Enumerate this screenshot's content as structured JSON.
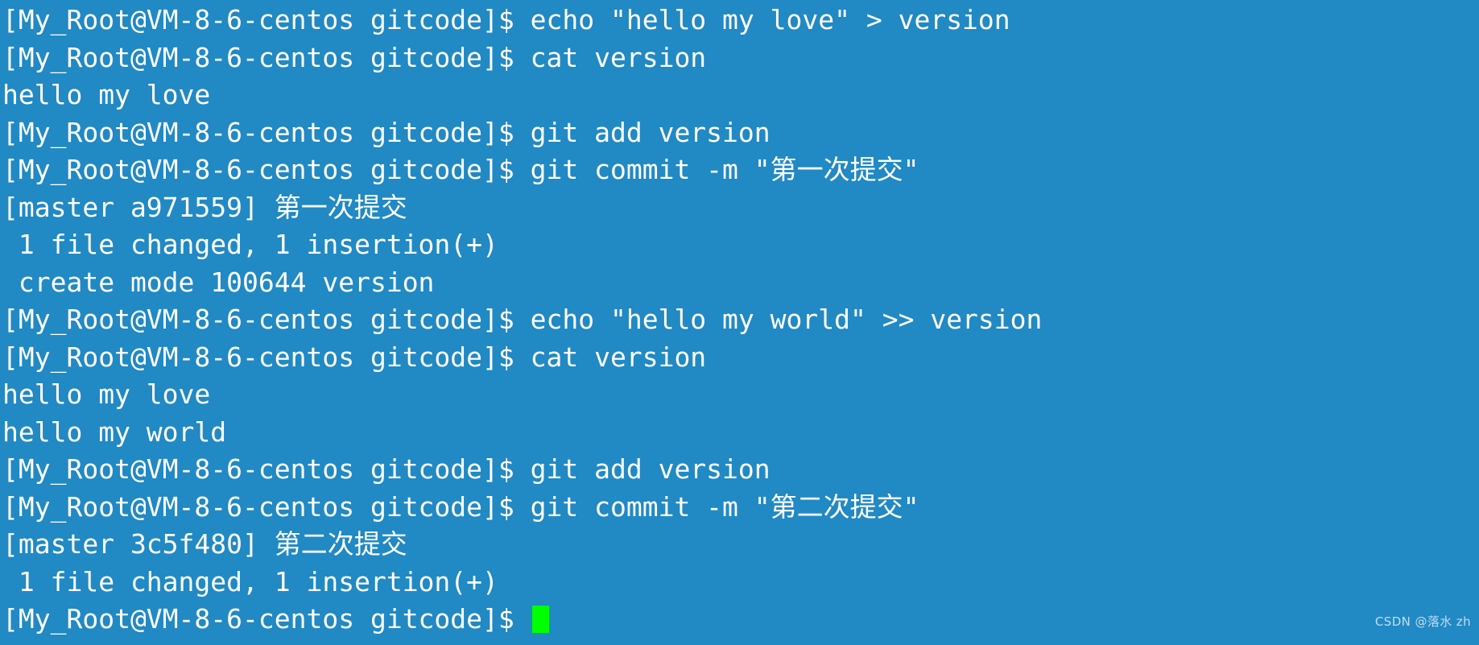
{
  "terminal": {
    "background_color": "#2189c4",
    "text_color": "#ffffff",
    "cursor_color": "#00ff00",
    "prompt": "[My_Root@VM-8-6-centos gitcode]$",
    "lines": [
      {
        "id": "line-1",
        "type": "prompt-command",
        "text": "[My_Root@VM-8-6-centos gitcode]$ echo \"hello my love\" > version"
      },
      {
        "id": "line-2",
        "type": "prompt-command",
        "text": "[My_Root@VM-8-6-centos gitcode]$ cat version"
      },
      {
        "id": "line-3",
        "type": "output",
        "text": "hello my love"
      },
      {
        "id": "line-4",
        "type": "prompt-command",
        "text": "[My_Root@VM-8-6-centos gitcode]$ git add version"
      },
      {
        "id": "line-5",
        "type": "prompt-command",
        "text": "[My_Root@VM-8-6-centos gitcode]$ git commit -m \"第一次提交\""
      },
      {
        "id": "line-6",
        "type": "output",
        "text": "[master a971559] 第一次提交"
      },
      {
        "id": "line-7",
        "type": "output",
        "text": " 1 file changed, 1 insertion(+)"
      },
      {
        "id": "line-8",
        "type": "output",
        "text": " create mode 100644 version"
      },
      {
        "id": "line-9",
        "type": "prompt-command",
        "text": "[My_Root@VM-8-6-centos gitcode]$ echo \"hello my world\" >> version"
      },
      {
        "id": "line-10",
        "type": "prompt-command",
        "text": "[My_Root@VM-8-6-centos gitcode]$ cat version"
      },
      {
        "id": "line-11",
        "type": "output",
        "text": "hello my love"
      },
      {
        "id": "line-12",
        "type": "output",
        "text": "hello my world"
      },
      {
        "id": "line-13",
        "type": "prompt-command",
        "text": "[My_Root@VM-8-6-centos gitcode]$ git add version"
      },
      {
        "id": "line-14",
        "type": "prompt-command",
        "text": "[My_Root@VM-8-6-centos gitcode]$ git commit -m \"第二次提交\""
      },
      {
        "id": "line-15",
        "type": "output",
        "text": "[master 3c5f480] 第二次提交"
      },
      {
        "id": "line-16",
        "type": "output",
        "text": " 1 file changed, 1 insertion(+)"
      },
      {
        "id": "line-17",
        "type": "prompt-cursor",
        "text": "[My_Root@VM-8-6-centos gitcode]$"
      }
    ]
  },
  "watermark": {
    "text": "CSDN @落水 zh"
  }
}
